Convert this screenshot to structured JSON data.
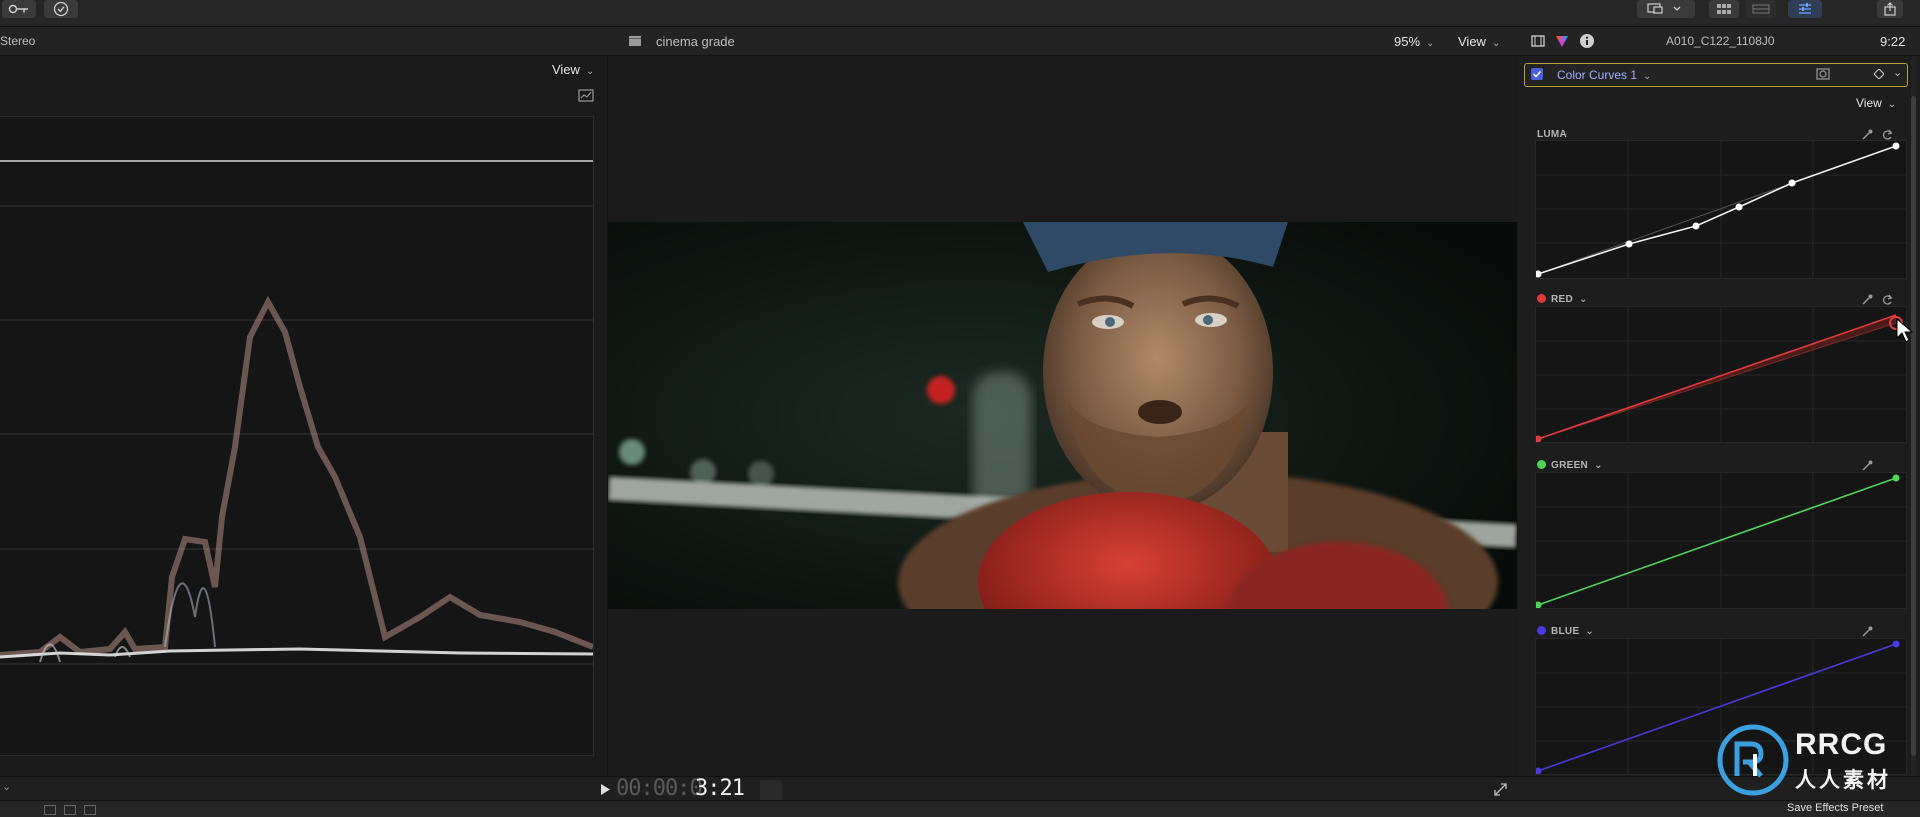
{
  "toolbar": {
    "keyword_icon": "key-icon",
    "background_tasks_icon": "checkmark-circle-icon",
    "display_icon": "display-icon",
    "share_icon": "share-icon"
  },
  "scopes": {
    "audio_label": "Stereo",
    "view_label": "View"
  },
  "viewer": {
    "title": "cinema grade",
    "zoom": "95%",
    "view_label": "View",
    "timecode_dim": "00:00:0",
    "timecode_bright": "3:21"
  },
  "inspector": {
    "clip_name": "A010_C122_1108J0",
    "duration": "9:22",
    "effect_name": "Color Curves 1",
    "effect_enabled": true,
    "view_label": "View",
    "curves": [
      {
        "label": "LUMA",
        "color": "#ffffff"
      },
      {
        "label": "RED",
        "color": "#e03a3a"
      },
      {
        "label": "GREEN",
        "color": "#4fd65a"
      },
      {
        "label": "BLUE",
        "color": "#4a3adf"
      }
    ],
    "save_preset_label": "Save Effects Preset"
  },
  "watermark": {
    "brand": "RRCG",
    "brand_cn": "人人素材"
  }
}
